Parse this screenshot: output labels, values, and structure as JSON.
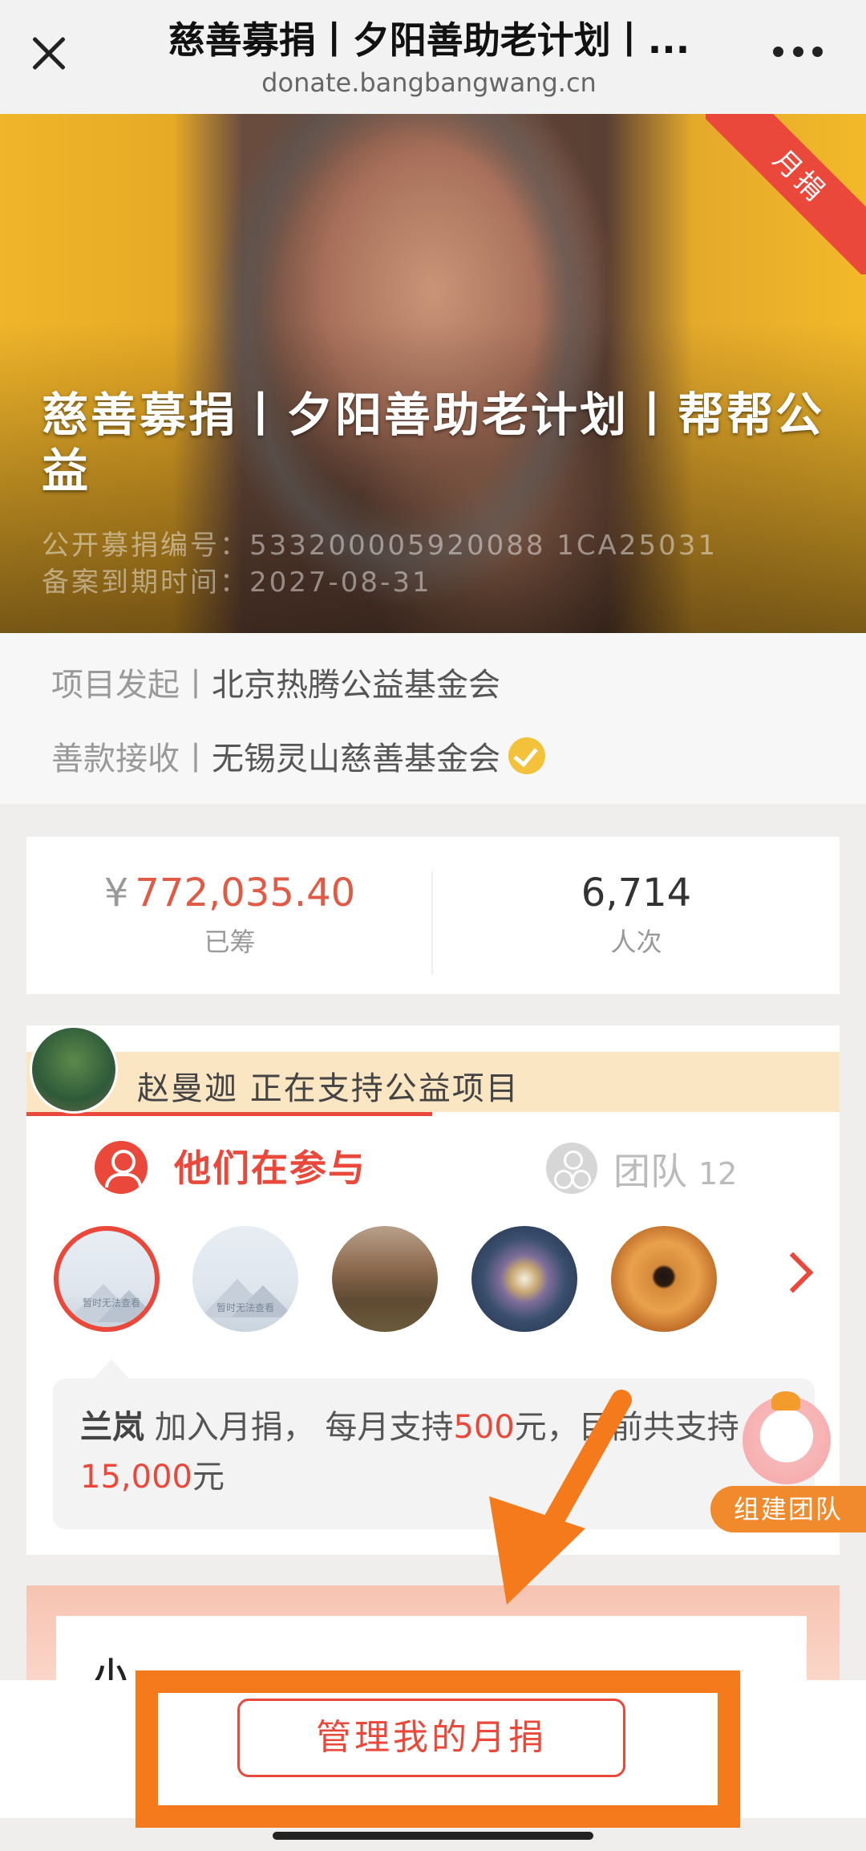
{
  "browser": {
    "title": "慈善募捐丨夕阳善助老计划丨...",
    "url": "donate.bangbangwang.cn"
  },
  "banner": {
    "ribbon": "月捐",
    "title": "慈善募捐丨夕阳善助老计划丨帮帮公益",
    "reg_number": "公开募捐编号：533200005920088 1CA25031",
    "expiry": "备案到期时间：2027-08-31"
  },
  "org": {
    "initiator_label": "项目发起丨",
    "initiator": "北京热腾公益基金会",
    "receiver_label": "善款接收丨",
    "receiver": "无锡灵山慈善基金会"
  },
  "stats": {
    "currency": "¥",
    "amount": "772,035.40",
    "amount_label": "已筹",
    "count": "6,714",
    "count_label": "人次"
  },
  "participants": {
    "supporter_text": "赵曼迦 正在支持公益项目",
    "tab_active": "他们在参与",
    "tab_team": "团队",
    "team_count": "12",
    "placeholder_text": "暂时无法查看",
    "message": {
      "name": "兰岚",
      "part1": " 加入月捐， 每月支持",
      "monthly": "500",
      "part2": "元，目前共支持",
      "total": "15,000",
      "part3": "元"
    }
  },
  "team_button": "组建团队",
  "bottom": {
    "card_text": "小",
    "manage_label": "管理我的月捐"
  },
  "colors": {
    "accent": "#e9483a",
    "annotation": "#f47a1b",
    "team_button": "#f08a2c"
  }
}
